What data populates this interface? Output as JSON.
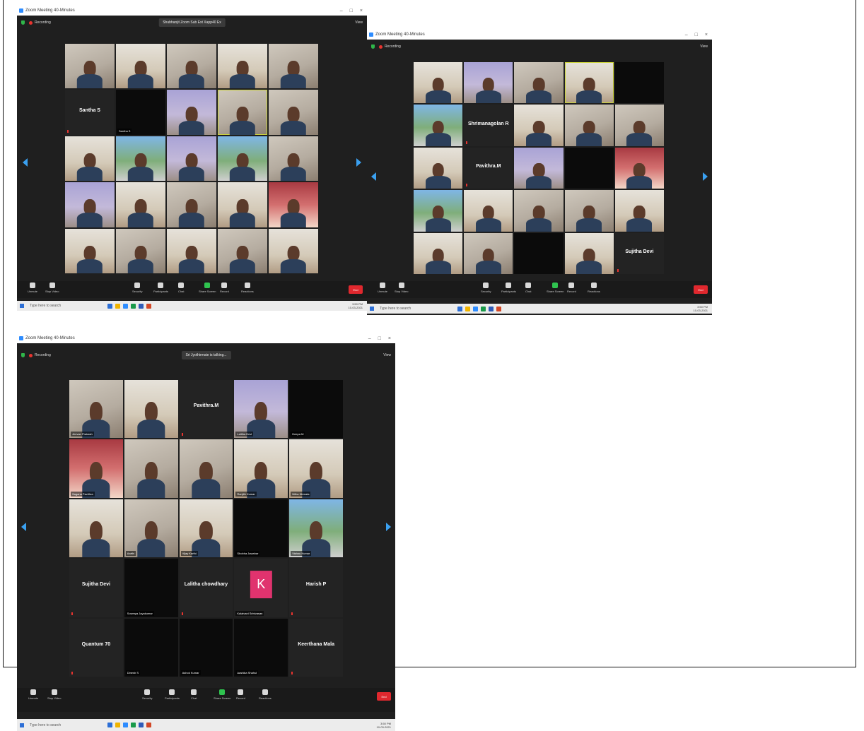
{
  "screens": [
    {
      "window_title": "Zoom Meeting 40-Minutes",
      "recording": "Recording",
      "speaker": "Shubhanjit Zoom Sub Ext Xapp40 Ex",
      "view": "View",
      "participants": [
        {
          "name": "",
          "style": "video"
        },
        {
          "name": "",
          "style": "v2"
        },
        {
          "name": "",
          "style": "video"
        },
        {
          "name": "",
          "style": "v2"
        },
        {
          "name": "",
          "style": "video"
        },
        {
          "name": "Santha S",
          "style": "name"
        },
        {
          "name": "Santha S",
          "style": "dark"
        },
        {
          "name": "",
          "style": "v5"
        },
        {
          "name": "",
          "style": "video",
          "active": true
        },
        {
          "name": "",
          "style": "video"
        },
        {
          "name": "",
          "style": "v2"
        },
        {
          "name": "",
          "style": "v4"
        },
        {
          "name": "",
          "style": "v5"
        },
        {
          "name": "",
          "style": "v4"
        },
        {
          "name": "",
          "style": "video"
        },
        {
          "name": "",
          "style": "v5"
        },
        {
          "name": "",
          "style": "v2"
        },
        {
          "name": "",
          "style": "video"
        },
        {
          "name": "",
          "style": "v2"
        },
        {
          "name": "",
          "style": "v3"
        },
        {
          "name": "",
          "style": "v2"
        },
        {
          "name": "",
          "style": "video"
        },
        {
          "name": "",
          "style": "v2"
        },
        {
          "name": "",
          "style": "video"
        },
        {
          "name": "",
          "style": "v2"
        }
      ]
    },
    {
      "window_title": "Zoom Meeting 40-Minutes",
      "recording": "Recording",
      "speaker": "",
      "view": "View",
      "participants": [
        {
          "name": "",
          "style": "v2"
        },
        {
          "name": "",
          "style": "v5"
        },
        {
          "name": "",
          "style": "video"
        },
        {
          "name": "",
          "style": "v2",
          "active": true
        },
        {
          "name": "",
          "style": "dark"
        },
        {
          "name": "",
          "style": "v4"
        },
        {
          "name": "Shrimanagolan R",
          "style": "name"
        },
        {
          "name": "",
          "style": "v2"
        },
        {
          "name": "",
          "style": "video"
        },
        {
          "name": "",
          "style": "video"
        },
        {
          "name": "",
          "style": "v2"
        },
        {
          "name": "Pavithra.M",
          "style": "name"
        },
        {
          "name": "",
          "style": "v5"
        },
        {
          "name": "",
          "style": "dark"
        },
        {
          "name": "",
          "style": "v3"
        },
        {
          "name": "",
          "style": "v4"
        },
        {
          "name": "",
          "style": "v2"
        },
        {
          "name": "",
          "style": "video"
        },
        {
          "name": "",
          "style": "video"
        },
        {
          "name": "",
          "style": "v2"
        },
        {
          "name": "",
          "style": "v2"
        },
        {
          "name": "",
          "style": "video"
        },
        {
          "name": "",
          "style": "dark"
        },
        {
          "name": "",
          "style": "v2"
        },
        {
          "name": "Sujitha Devi",
          "style": "name"
        }
      ]
    },
    {
      "window_title": "Zoom Meeting 40-Minutes",
      "recording": "Recording",
      "speaker": "Sri Jyothirmaie is talking...",
      "view": "View",
      "participants": [
        {
          "name": "Jeevan Prakash",
          "style": "video"
        },
        {
          "name": "",
          "style": "v2"
        },
        {
          "name": "Pavithra.M",
          "style": "name"
        },
        {
          "name": "Lalitha Devi",
          "style": "v5"
        },
        {
          "name": "Deepa M",
          "style": "dark"
        },
        {
          "name": "Sagana Pavithra",
          "style": "v3"
        },
        {
          "name": "",
          "style": "video"
        },
        {
          "name": "",
          "style": "video"
        },
        {
          "name": "Ranjith Kumar",
          "style": "v2"
        },
        {
          "name": "Nitha Nirmala",
          "style": "v2"
        },
        {
          "name": "",
          "style": "v2"
        },
        {
          "name": "Aarthi",
          "style": "video"
        },
        {
          "name": "Vijay Karthi",
          "style": "v2"
        },
        {
          "name": "Shobha Jawahar",
          "style": "dark"
        },
        {
          "name": "Vishnu Kumar",
          "style": "v4"
        },
        {
          "name": "Sujitha Devi",
          "style": "name"
        },
        {
          "name": "Sowmya Jayakumar",
          "style": "dark"
        },
        {
          "name": "Lalitha chowdhary",
          "style": "name"
        },
        {
          "name": "Kalaivani Srinivasan",
          "style": "k"
        },
        {
          "name": "Harish P",
          "style": "name"
        },
        {
          "name": "Quantum 70",
          "style": "name"
        },
        {
          "name": "Dinesh S",
          "style": "dark"
        },
        {
          "name": "Ashok Kumar",
          "style": "dark"
        },
        {
          "name": "Aashika Shahul",
          "style": "dark"
        },
        {
          "name": "Keerthana Mala",
          "style": "name"
        }
      ]
    }
  ],
  "toolbar": {
    "mute": "Unmute",
    "video": "Stop Video",
    "security": "Security",
    "participants": "Participants",
    "chat": "Chat",
    "share": "Share Screen",
    "record": "Record",
    "reactions": "Reactions",
    "end": "End"
  },
  "taskbar": {
    "search_placeholder": "Type here to search",
    "time": "3:50 PM",
    "date": "10-03-2021"
  },
  "colors": {
    "zoom_blue": "#2d8cff",
    "end_red": "#e0282e",
    "share_green": "#2fc34f",
    "active_border": "#cbd33b"
  }
}
